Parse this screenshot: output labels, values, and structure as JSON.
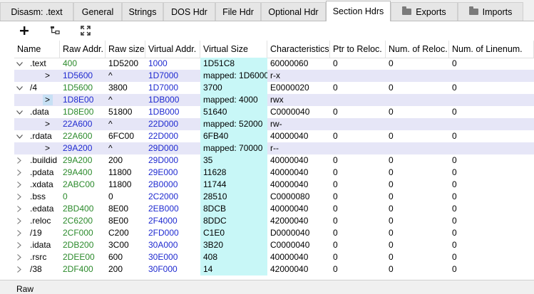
{
  "tabs": [
    {
      "label": "Disasm: .text",
      "icon": ""
    },
    {
      "label": "General",
      "icon": ""
    },
    {
      "label": "Strings",
      "icon": ""
    },
    {
      "label": "DOS Hdr",
      "icon": ""
    },
    {
      "label": "File Hdr",
      "icon": ""
    },
    {
      "label": "Optional Hdr",
      "icon": ""
    },
    {
      "label": "Section Hdrs",
      "icon": ""
    },
    {
      "label": "Exports",
      "icon": "folder-icon"
    },
    {
      "label": "Imports",
      "icon": "folder-icon"
    }
  ],
  "active_tab": "Section Hdrs",
  "toolbar": {
    "add_icon": "plus-icon",
    "dump_icon": "export-icon",
    "fit_icon": "fit-columns-icon"
  },
  "columns": [
    "Name",
    "Raw Addr.",
    "Raw size",
    "Virtual Addr.",
    "Virtual Size",
    "Characteristics",
    "Ptr to Reloc.",
    "Num. of Reloc.",
    "Num. of Linenum."
  ],
  "rows": [
    {
      "type": "section",
      "expanded": true,
      "name": ".text",
      "raw_addr": "400",
      "raw_size": "1D5200",
      "virt_addr": "1000",
      "virt_size": "1D51C8",
      "characteristics": "60000060",
      "ptr_reloc": "0",
      "num_reloc": "0",
      "num_linenum": "0",
      "raw_color": "green"
    },
    {
      "type": "sub",
      "arrow": ">",
      "raw_addr": "1D5600",
      "raw_size": "^",
      "virt_addr": "1D7000",
      "virt_size": "mapped: 1D6000",
      "characteristics": "r-x"
    },
    {
      "type": "section",
      "expanded": true,
      "name": "/4",
      "raw_addr": "1D5600",
      "raw_size": "3800",
      "virt_addr": "1D7000",
      "virt_size": "3700",
      "characteristics": "E0000020",
      "ptr_reloc": "0",
      "num_reloc": "0",
      "num_linenum": "0",
      "raw_color": "green"
    },
    {
      "type": "sub",
      "arrow": ">",
      "selected": true,
      "raw_addr": "1D8E00",
      "raw_size": "^",
      "virt_addr": "1DB000",
      "virt_size": "mapped: 4000",
      "characteristics": "rwx"
    },
    {
      "type": "section",
      "expanded": true,
      "name": ".data",
      "raw_addr": "1D8E00",
      "raw_size": "51800",
      "virt_addr": "1DB000",
      "virt_size": "51640",
      "characteristics": "C0000040",
      "ptr_reloc": "0",
      "num_reloc": "0",
      "num_linenum": "0",
      "raw_color": "green"
    },
    {
      "type": "sub",
      "arrow": ">",
      "raw_addr": "22A600",
      "raw_size": "^",
      "virt_addr": "22D000",
      "virt_size": "mapped: 52000",
      "characteristics": "rw-"
    },
    {
      "type": "section",
      "expanded": true,
      "name": ".rdata",
      "raw_addr": "22A600",
      "raw_size": "6FC00",
      "virt_addr": "22D000",
      "virt_size": "6FB40",
      "characteristics": "40000040",
      "ptr_reloc": "0",
      "num_reloc": "0",
      "num_linenum": "0",
      "raw_color": "green"
    },
    {
      "type": "sub",
      "arrow": ">",
      "raw_addr": "29A200",
      "raw_size": "^",
      "virt_addr": "29D000",
      "virt_size": "mapped: 70000",
      "characteristics": "r--"
    },
    {
      "type": "section",
      "expanded": false,
      "name": ".buildid",
      "raw_addr": "29A200",
      "raw_size": "200",
      "virt_addr": "29D000",
      "virt_size": "35",
      "characteristics": "40000040",
      "ptr_reloc": "0",
      "num_reloc": "0",
      "num_linenum": "0",
      "raw_color": "green"
    },
    {
      "type": "section",
      "expanded": false,
      "name": ".pdata",
      "raw_addr": "29A400",
      "raw_size": "11800",
      "virt_addr": "29E000",
      "virt_size": "11628",
      "characteristics": "40000040",
      "ptr_reloc": "0",
      "num_reloc": "0",
      "num_linenum": "0",
      "raw_color": "green"
    },
    {
      "type": "section",
      "expanded": false,
      "name": ".xdata",
      "raw_addr": "2ABC00",
      "raw_size": "11800",
      "virt_addr": "2B0000",
      "virt_size": "11744",
      "characteristics": "40000040",
      "ptr_reloc": "0",
      "num_reloc": "0",
      "num_linenum": "0",
      "raw_color": "green"
    },
    {
      "type": "section",
      "expanded": false,
      "name": ".bss",
      "raw_addr": "0",
      "raw_size": "0",
      "virt_addr": "2C2000",
      "virt_size": "28510",
      "characteristics": "C0000080",
      "ptr_reloc": "0",
      "num_reloc": "0",
      "num_linenum": "0",
      "raw_color": "green"
    },
    {
      "type": "section",
      "expanded": false,
      "name": ".edata",
      "raw_addr": "2BD400",
      "raw_size": "8E00",
      "virt_addr": "2EB000",
      "virt_size": "8DCB",
      "characteristics": "40000040",
      "ptr_reloc": "0",
      "num_reloc": "0",
      "num_linenum": "0",
      "raw_color": "green"
    },
    {
      "type": "section",
      "expanded": false,
      "name": ".reloc",
      "raw_addr": "2C6200",
      "raw_size": "8E00",
      "virt_addr": "2F4000",
      "virt_size": "8DDC",
      "characteristics": "42000040",
      "ptr_reloc": "0",
      "num_reloc": "0",
      "num_linenum": "0",
      "raw_color": "green"
    },
    {
      "type": "section",
      "expanded": false,
      "name": "/19",
      "raw_addr": "2CF000",
      "raw_size": "C200",
      "virt_addr": "2FD000",
      "virt_size": "C1E0",
      "characteristics": "D0000040",
      "ptr_reloc": "0",
      "num_reloc": "0",
      "num_linenum": "0",
      "raw_color": "green"
    },
    {
      "type": "section",
      "expanded": false,
      "name": ".idata",
      "raw_addr": "2DB200",
      "raw_size": "3C00",
      "virt_addr": "30A000",
      "virt_size": "3B20",
      "characteristics": "C0000040",
      "ptr_reloc": "0",
      "num_reloc": "0",
      "num_linenum": "0",
      "raw_color": "green"
    },
    {
      "type": "section",
      "expanded": false,
      "name": ".rsrc",
      "raw_addr": "2DEE00",
      "raw_size": "600",
      "virt_addr": "30E000",
      "virt_size": "408",
      "characteristics": "40000040",
      "ptr_reloc": "0",
      "num_reloc": "0",
      "num_linenum": "0",
      "raw_color": "green"
    },
    {
      "type": "section",
      "expanded": false,
      "name": "/38",
      "raw_addr": "2DF400",
      "raw_size": "200",
      "virt_addr": "30F000",
      "virt_size": "14",
      "characteristics": "42000040",
      "ptr_reloc": "0",
      "num_reloc": "0",
      "num_linenum": "0",
      "raw_color": "green"
    }
  ],
  "bottom_panel": {
    "label": "Raw"
  },
  "colors": {
    "active_tab_bg": "#ffffff",
    "virtual_size_bg": "#c8f7f7",
    "mapped_row_bg": "#e6e6f7",
    "addr_blue": "#1f2ad0",
    "raw_green": "#2b8a2b"
  }
}
